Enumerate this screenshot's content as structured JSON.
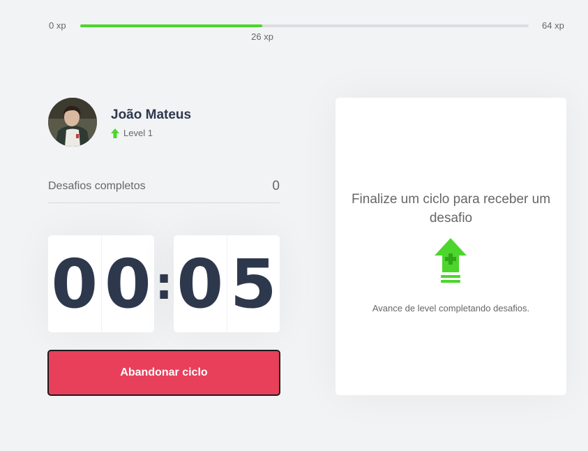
{
  "xp": {
    "min_label": "0 xp",
    "max_label": "64 xp",
    "current_label": "26 xp",
    "progress_fraction": 0.406,
    "fill_color": "#4cd62b"
  },
  "profile": {
    "name": "João Mateus",
    "level_label": "Level 1",
    "level_icon": "level-up-arrow-icon"
  },
  "challenges": {
    "completed_label": "Desafios completos",
    "completed_count": "0"
  },
  "countdown": {
    "minute_left": "0",
    "minute_right": "0",
    "separator": ":",
    "second_left": "0",
    "second_right": "5"
  },
  "abandon_button": {
    "label": "Abandonar ciclo",
    "color": "#e83f5b"
  },
  "challenge_box": {
    "title": "Finalize um ciclo para receber um desafio",
    "icon": "level-up-icon",
    "description": "Avance de level completando desafios."
  }
}
